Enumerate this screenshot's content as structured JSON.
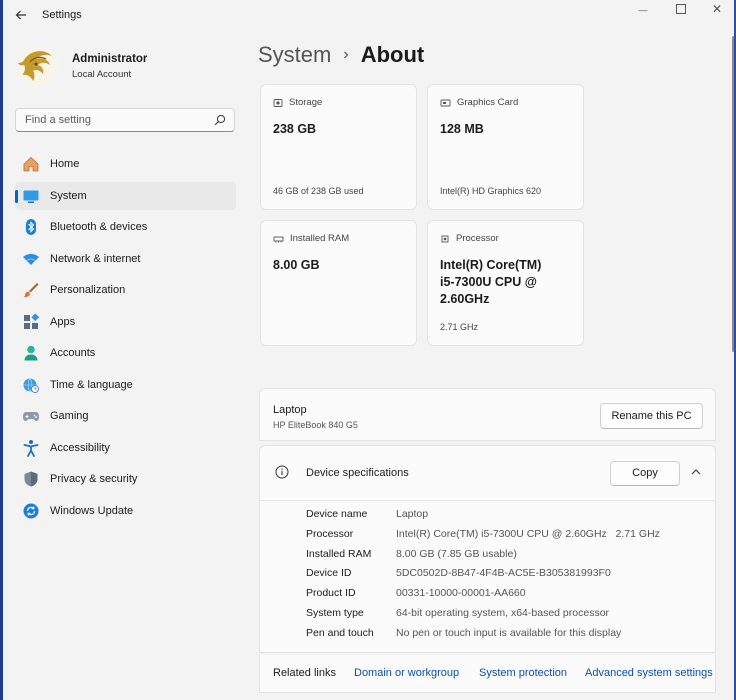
{
  "window": {
    "title": "Settings",
    "back_icon": "arrow-left-icon",
    "minimize_glyph": "—",
    "close_glyph": "✕"
  },
  "user": {
    "name": "Administrator",
    "account_type": "Local Account"
  },
  "search": {
    "placeholder": "Find a setting",
    "icon": "search-icon"
  },
  "sidebar": {
    "items": [
      {
        "label": "Home",
        "icon": "home-icon",
        "active": false
      },
      {
        "label": "System",
        "icon": "system-monitor-icon",
        "active": true
      },
      {
        "label": "Bluetooth & devices",
        "icon": "bluetooth-icon",
        "active": false
      },
      {
        "label": "Network & internet",
        "icon": "wifi-icon",
        "active": false
      },
      {
        "label": "Personalization",
        "icon": "brush-icon",
        "active": false
      },
      {
        "label": "Apps",
        "icon": "apps-icon",
        "active": false
      },
      {
        "label": "Accounts",
        "icon": "person-icon",
        "active": false
      },
      {
        "label": "Time & language",
        "icon": "globe-clock-icon",
        "active": false
      },
      {
        "label": "Gaming",
        "icon": "gamepad-icon",
        "active": false
      },
      {
        "label": "Accessibility",
        "icon": "accessibility-icon",
        "active": false
      },
      {
        "label": "Privacy & security",
        "icon": "shield-icon",
        "active": false
      },
      {
        "label": "Windows Update",
        "icon": "update-icon",
        "active": false
      }
    ]
  },
  "breadcrumb": {
    "parent": "System",
    "separator": "›",
    "current": "About"
  },
  "cards": {
    "storage": {
      "label": "Storage",
      "value": "238 GB",
      "detail": "46 GB of 238 GB used",
      "icon": "storage-icon"
    },
    "graphics": {
      "label": "Graphics Card",
      "value": "128 MB",
      "detail": "Intel(R) HD Graphics 620",
      "icon": "graphics-card-icon"
    },
    "ram": {
      "label": "Installed RAM",
      "value": "8.00 GB",
      "icon": "ram-icon"
    },
    "processor": {
      "label": "Processor",
      "value_lines": [
        "Intel(R) Core(TM)",
        "i5-7300U CPU @",
        "2.60GHz"
      ],
      "detail": "2.71 GHz",
      "icon": "processor-icon"
    }
  },
  "device": {
    "name": "Laptop",
    "model": "HP EliteBook 840 G5",
    "rename_label": "Rename this PC"
  },
  "specs": {
    "title": "Device specifications",
    "copy_label": "Copy",
    "collapse_icon": "chevron-up-icon",
    "rows": [
      {
        "key": "Device name",
        "value": "Laptop"
      },
      {
        "key": "Processor",
        "value": "Intel(R) Core(TM) i5-7300U CPU @ 2.60GHz   2.71 GHz"
      },
      {
        "key": "Installed RAM",
        "value": "8.00 GB (7.85 GB usable)"
      },
      {
        "key": "Device ID",
        "value": "5DC0502D-8B47-4F4B-AC5E-B305381993F0"
      },
      {
        "key": "Product ID",
        "value": "00331-10000-00001-AA660"
      },
      {
        "key": "System type",
        "value": "64-bit operating system, x64-based processor"
      },
      {
        "key": "Pen and touch",
        "value": "No pen or touch input is available for this display"
      }
    ]
  },
  "related": {
    "label": "Related links",
    "links": [
      "Domain or workgroup",
      "System protection",
      "Advanced system settings"
    ]
  },
  "colors": {
    "accent": "#0067c0",
    "background": "#f3f3f3",
    "card": "#fbfbfb",
    "link": "#0a4fa8"
  }
}
